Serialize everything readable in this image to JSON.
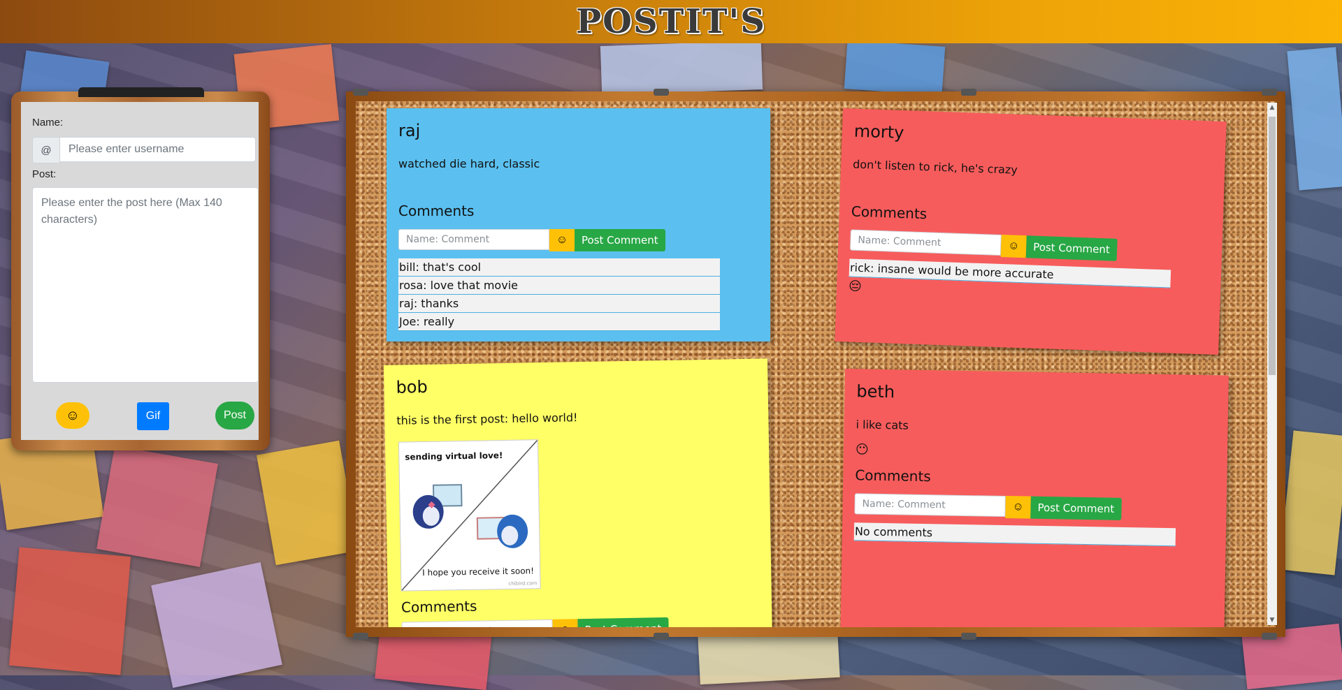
{
  "header": {
    "title": "POSTIT'S"
  },
  "form": {
    "name_label": "Name:",
    "at_symbol": "@",
    "username_placeholder": "Please enter username",
    "post_label": "Post:",
    "post_placeholder": "Please enter the post here (Max 140 characters)",
    "emoji_icon": "☺",
    "gif_label": "Gif",
    "post_button_label": "Post"
  },
  "comment_form": {
    "placeholder": "Name: Comment",
    "emoji_icon": "☺",
    "post_comment_label": "Post Comment"
  },
  "posts": [
    {
      "author": "raj",
      "body": "watched die hard, classic",
      "color": "#5bc0f0",
      "comments_heading": "Comments",
      "comments": [
        "bill: that's cool",
        "rosa: love that movie",
        "raj: thanks",
        "Joe: really"
      ]
    },
    {
      "author": "morty",
      "body": "don't listen to rick, he's crazy",
      "color": "#f75c5c",
      "comments_heading": "Comments",
      "comments": [
        "rick: insane would be more accurate"
      ],
      "comment_emoji": "😔"
    },
    {
      "author": "bob",
      "body": "this is the first post: hello world!",
      "color": "#ffff66",
      "comments_heading": "Comments",
      "gif": {
        "top_text": "sending virtual love!",
        "bottom_text": "I hope you receive it soon!",
        "watermark": "chibird.com"
      }
    },
    {
      "author": "beth",
      "body": "i like cats",
      "color": "#f75c5c",
      "emoji": "😶",
      "comments_heading": "Comments",
      "comments": [
        "No comments"
      ]
    }
  ],
  "colors": {
    "accent_blue": "#007bff",
    "accent_green": "#28a745",
    "accent_yellow": "#ffc107"
  }
}
